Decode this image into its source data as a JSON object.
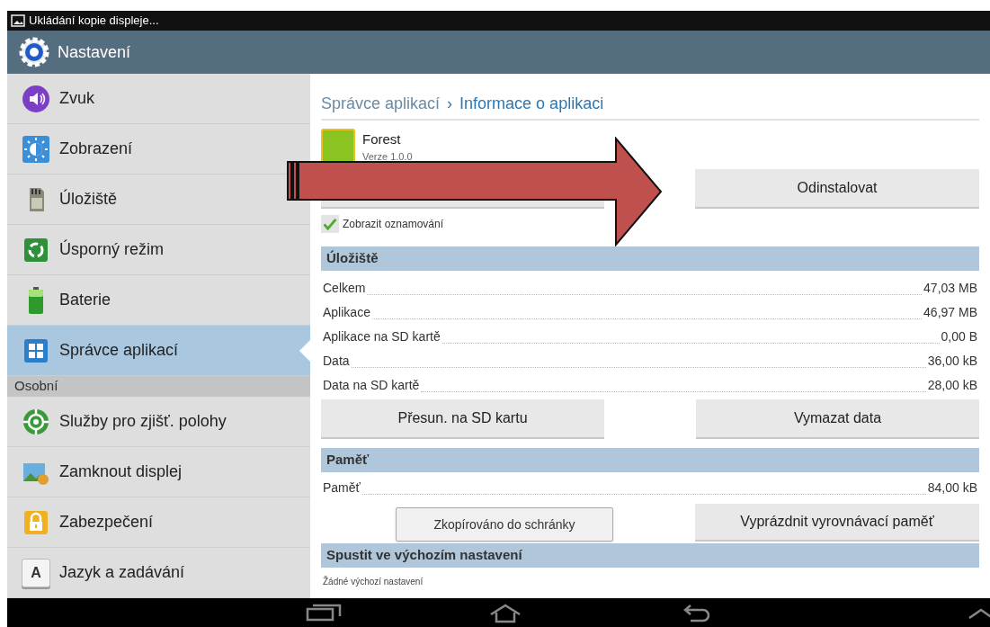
{
  "status_bar": {
    "notification": "Ukládání kopie displeje..."
  },
  "title_bar": {
    "title": "Nastavení"
  },
  "sidebar": {
    "items": [
      {
        "kind": "item",
        "label": "Zvuk",
        "selected": false
      },
      {
        "kind": "item",
        "label": "Zobrazení",
        "selected": false
      },
      {
        "kind": "item",
        "label": "Úložiště",
        "selected": false
      },
      {
        "kind": "item",
        "label": "Úsporný režim",
        "selected": false
      },
      {
        "kind": "item",
        "label": "Baterie",
        "selected": false
      },
      {
        "kind": "item",
        "label": "Správce aplikací",
        "selected": true
      },
      {
        "kind": "header",
        "label": "Osobní"
      },
      {
        "kind": "item",
        "label": "Služby pro zjišť. polohy",
        "selected": false
      },
      {
        "kind": "item",
        "label": "Zamknout displej",
        "selected": false
      },
      {
        "kind": "item",
        "label": "Zabezpečení",
        "selected": false
      },
      {
        "kind": "item",
        "icon_glyph": "A",
        "label": "Jazyk a zadávání",
        "selected": false
      }
    ]
  },
  "breadcrumb": {
    "parent": "Správce aplikací",
    "separator": "›",
    "current": "Informace o aplikaci"
  },
  "app": {
    "name": "Forest",
    "version": "Verze 1.0.0"
  },
  "top_buttons": {
    "right": "Odinstalovat"
  },
  "notifications_checkbox": {
    "label": "Zobrazit oznamování",
    "checked": true
  },
  "storage": {
    "title": "Úložiště",
    "rows": [
      {
        "label": "Celkem",
        "value": "47,03 MB"
      },
      {
        "label": "Aplikace",
        "value": "46,97 MB"
      },
      {
        "label": "Aplikace na SD kartě",
        "value": "0,00 B"
      },
      {
        "label": "Data",
        "value": "36,00 kB"
      },
      {
        "label": "Data na SD kartě",
        "value": "28,00 kB"
      }
    ],
    "buttons": [
      "Přesun. na SD kartu",
      "Vymazat data"
    ]
  },
  "memory": {
    "title": "Paměť",
    "rows": [
      {
        "label": "Paměť",
        "value": "84,00 kB"
      }
    ],
    "button": "Vyprázdnit vyrovnávací paměť"
  },
  "defaults": {
    "title": "Spustit ve výchozím nastavení",
    "text": "Žádné výchozí nastavení"
  },
  "toast": "Zkopírováno do schránky"
}
